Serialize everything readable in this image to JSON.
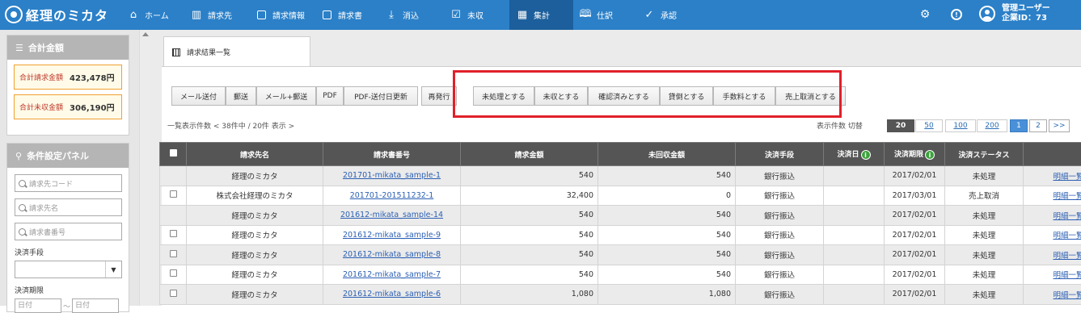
{
  "brand": {
    "name": "経理のミカタ"
  },
  "nav": {
    "items": [
      {
        "label": "ホーム",
        "icon": "home-icon"
      },
      {
        "label": "請求先",
        "icon": "building-icon"
      },
      {
        "label": "請求情報",
        "icon": "wallet-icon"
      },
      {
        "label": "請求書",
        "icon": "invoice-icon"
      },
      {
        "label": "消込",
        "icon": "download-icon"
      },
      {
        "label": "未収",
        "icon": "checkbox-icon"
      },
      {
        "label": "集計",
        "icon": "calculator-icon",
        "active": true
      },
      {
        "label": "仕訳",
        "icon": "book-icon"
      },
      {
        "label": "承認",
        "icon": "check-circle-icon"
      }
    ],
    "user": {
      "line1": "管理ユーザー",
      "line2": "企業ID：73"
    }
  },
  "sidebar": {
    "totals": {
      "title": "合計金額",
      "billed_label": "合計請求金額",
      "billed_value": "423,478円",
      "unpaid_label": "合計未収金額",
      "unpaid_value": "306,190円"
    },
    "filter": {
      "title": "条件設定パネル",
      "customer_code_placeholder": "請求先コード",
      "customer_name_placeholder": "請求先名",
      "invoice_no_placeholder": "請求書番号",
      "payment_method_label": "決済手段",
      "due_date_label": "決済期限",
      "date_from_placeholder": "日付",
      "date_sep": "〜",
      "date_to_placeholder": "日付"
    }
  },
  "main": {
    "tab_label": "請求結果一覧",
    "actions_left": [
      "メール送付",
      "郵送",
      "メール+郵送",
      "PDF",
      "PDF-送付日更新",
      "再発行"
    ],
    "actions_right": [
      "未処理とする",
      "未収とする",
      "確認済みとする",
      "貸倒とする",
      "手数料とする",
      "売上取消とする"
    ],
    "count_text": "一覧表示件数 < 38件中 / 20件 表示 >",
    "per_page_label": "表示件数 切替",
    "per_page_options": [
      "20",
      "50",
      "100",
      "200"
    ],
    "pages": [
      "1",
      "2",
      ">>"
    ]
  },
  "table": {
    "headers": [
      "請求先名",
      "請求書番号",
      "請求金額",
      "未回収金額",
      "決済手段",
      "決済日",
      "決済期限",
      "決済ステータス",
      ""
    ],
    "info_icon_text": "i",
    "rows": [
      {
        "customer": "経理のミカタ",
        "invoice": "201701-mikata_sample-1",
        "amount": "540",
        "unpaid": "540",
        "method": "銀行振込",
        "paid_date": "",
        "due": "2017/02/01",
        "status": "未処理",
        "detail": "明細一覧",
        "checkbox": false
      },
      {
        "customer": "株式会社経理のミカタ",
        "invoice": "201701-201511232-1",
        "amount": "32,400",
        "unpaid": "0",
        "method": "銀行振込",
        "paid_date": "",
        "due": "2017/03/01",
        "status": "売上取消",
        "detail": "明細一覧",
        "checkbox": true
      },
      {
        "customer": "経理のミカタ",
        "invoice": "201612-mikata_sample-14",
        "amount": "540",
        "unpaid": "540",
        "method": "銀行振込",
        "paid_date": "",
        "due": "2017/02/01",
        "status": "未処理",
        "detail": "明細一覧",
        "checkbox": false
      },
      {
        "customer": "経理のミカタ",
        "invoice": "201612-mikata_sample-9",
        "amount": "540",
        "unpaid": "540",
        "method": "銀行振込",
        "paid_date": "",
        "due": "2017/02/01",
        "status": "未処理",
        "detail": "明細一覧",
        "checkbox": true
      },
      {
        "customer": "経理のミカタ",
        "invoice": "201612-mikata_sample-8",
        "amount": "540",
        "unpaid": "540",
        "method": "銀行振込",
        "paid_date": "",
        "due": "2017/02/01",
        "status": "未処理",
        "detail": "明細一覧",
        "checkbox": true
      },
      {
        "customer": "経理のミカタ",
        "invoice": "201612-mikata_sample-7",
        "amount": "540",
        "unpaid": "540",
        "method": "銀行振込",
        "paid_date": "",
        "due": "2017/02/01",
        "status": "未処理",
        "detail": "明細一覧",
        "checkbox": true
      },
      {
        "customer": "経理のミカタ",
        "invoice": "201612-mikata_sample-6",
        "amount": "1,080",
        "unpaid": "1,080",
        "method": "銀行振込",
        "paid_date": "",
        "due": "2017/02/01",
        "status": "未処理",
        "detail": "明細一覧",
        "checkbox": true
      }
    ]
  },
  "colors": {
    "nav_bg": "#2b80c8",
    "nav_active": "#1c5f9c",
    "highlight": "#e0202a",
    "link": "#2b5fb3"
  }
}
